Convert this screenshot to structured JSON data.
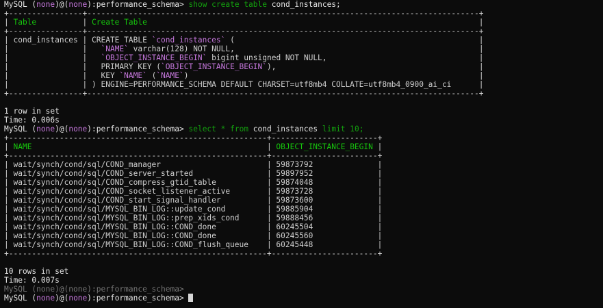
{
  "prompt": {
    "prefix": "MySQL (",
    "none": "none",
    "mid": ")@(",
    "suffix": "):performance_schema>"
  },
  "cmd1": {
    "a": "show create table",
    "b": "cond_instances;"
  },
  "create_table": {
    "border": "+----------------+-------------------------------------------------------------------------------------------------------------+",
    "header": {
      "c1": "Table",
      "c2": "Create Table"
    },
    "rows": [
      {
        "c1": "cond_instances",
        "c2": "CREATE TABLE `cond_instances` ("
      },
      {
        "c1": "",
        "c2": "  `NAME` varchar(128) NOT NULL,"
      },
      {
        "c1": "",
        "c2": "  `OBJECT_INSTANCE_BEGIN` bigint unsigned NOT NULL,"
      },
      {
        "c1": "",
        "c2": "  PRIMARY KEY (`OBJECT_INSTANCE_BEGIN`),"
      },
      {
        "c1": "",
        "c2": "  KEY `NAME` (`NAME`)"
      },
      {
        "c1": "",
        "c2": ") ENGINE=PERFORMANCE_SCHEMA DEFAULT CHARSET=utf8mb4 COLLATE=utf8mb4_0900_ai_ci"
      }
    ]
  },
  "result1": {
    "rows": "1 row in set",
    "time": "Time: 0.006s"
  },
  "cmd2": {
    "a": "select * from",
    "b": "cond_instances",
    "c": "limit 10;"
  },
  "select_table": {
    "header": {
      "c1": "NAME",
      "c2": "OBJECT_INSTANCE_BEGIN"
    },
    "rows": [
      {
        "name": "wait/synch/cond/sql/COND_manager",
        "obj": "59873792"
      },
      {
        "name": "wait/synch/cond/sql/COND_server_started",
        "obj": "59897952"
      },
      {
        "name": "wait/synch/cond/sql/COND_compress_gtid_table",
        "obj": "59874048"
      },
      {
        "name": "wait/synch/cond/sql/COND_socket_listener_active",
        "obj": "59873728"
      },
      {
        "name": "wait/synch/cond/sql/COND_start_signal_handler",
        "obj": "59873600"
      },
      {
        "name": "wait/synch/cond/sql/MYSQL_BIN_LOG::update_cond",
        "obj": "59885904"
      },
      {
        "name": "wait/synch/cond/sql/MYSQL_BIN_LOG::prep_xids_cond",
        "obj": "59888456"
      },
      {
        "name": "wait/synch/cond/sql/MYSQL_BIN_LOG::COND_done",
        "obj": "60245504"
      },
      {
        "name": "wait/synch/cond/sql/MYSQL_BIN_LOG::COND_done",
        "obj": "60245560"
      },
      {
        "name": "wait/synch/cond/sql/MYSQL_BIN_LOG::COND_flush_queue",
        "obj": "60245448"
      }
    ]
  },
  "result2": {
    "rows": "10 rows in set",
    "time": "Time: 0.007s"
  }
}
